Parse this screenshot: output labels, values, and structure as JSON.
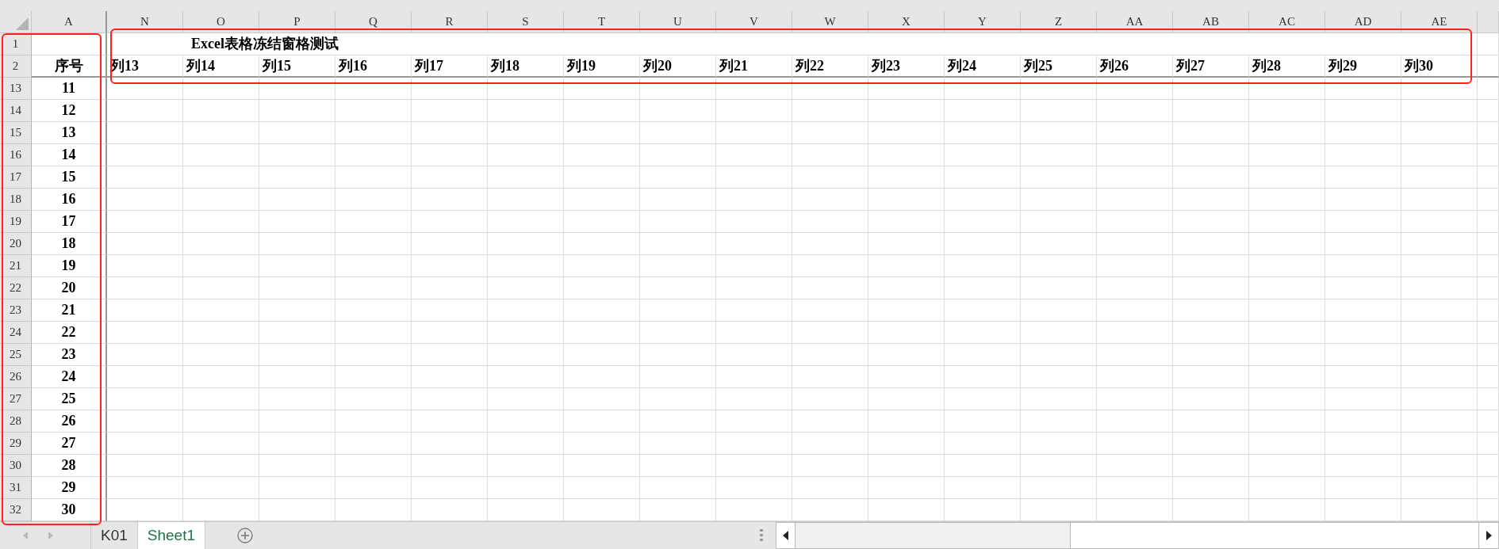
{
  "column_headers": {
    "frozen": "A",
    "scrolled": [
      "N",
      "O",
      "P",
      "Q",
      "R",
      "S",
      "T",
      "U",
      "V",
      "W",
      "X",
      "Y",
      "Z",
      "AA",
      "AB",
      "AC",
      "AD",
      "AE"
    ]
  },
  "rows": [
    {
      "header": "1",
      "kind": "title",
      "title": "Excel表格冻结窗格测试"
    },
    {
      "header": "2",
      "kind": "labels",
      "a": "序号",
      "labels": [
        "列13",
        "列14",
        "列15",
        "列16",
        "列17",
        "列18",
        "列19",
        "列20",
        "列21",
        "列22",
        "列23",
        "列24",
        "列25",
        "列26",
        "列27",
        "列28",
        "列29",
        "列30"
      ]
    },
    {
      "header": "13",
      "kind": "data",
      "a": "11"
    },
    {
      "header": "14",
      "kind": "data",
      "a": "12"
    },
    {
      "header": "15",
      "kind": "data",
      "a": "13"
    },
    {
      "header": "16",
      "kind": "data",
      "a": "14"
    },
    {
      "header": "17",
      "kind": "data",
      "a": "15"
    },
    {
      "header": "18",
      "kind": "data",
      "a": "16"
    },
    {
      "header": "19",
      "kind": "data",
      "a": "17"
    },
    {
      "header": "20",
      "kind": "data",
      "a": "18"
    },
    {
      "header": "21",
      "kind": "data",
      "a": "19"
    },
    {
      "header": "22",
      "kind": "data",
      "a": "20"
    },
    {
      "header": "23",
      "kind": "data",
      "a": "21"
    },
    {
      "header": "24",
      "kind": "data",
      "a": "22"
    },
    {
      "header": "25",
      "kind": "data",
      "a": "23"
    },
    {
      "header": "26",
      "kind": "data",
      "a": "24"
    },
    {
      "header": "27",
      "kind": "data",
      "a": "25"
    },
    {
      "header": "28",
      "kind": "data",
      "a": "26"
    },
    {
      "header": "29",
      "kind": "data",
      "a": "27"
    },
    {
      "header": "30",
      "kind": "data",
      "a": "28"
    },
    {
      "header": "31",
      "kind": "data",
      "a": "29"
    },
    {
      "header": "32",
      "kind": "data",
      "a": "30"
    }
  ],
  "highlights": [
    {
      "color": "#ff2020"
    },
    {
      "color": "#ff2020"
    }
  ],
  "sheet_tabs": [
    {
      "label": "K01",
      "selected": false
    },
    {
      "label": "Sheet1",
      "selected": true
    }
  ]
}
